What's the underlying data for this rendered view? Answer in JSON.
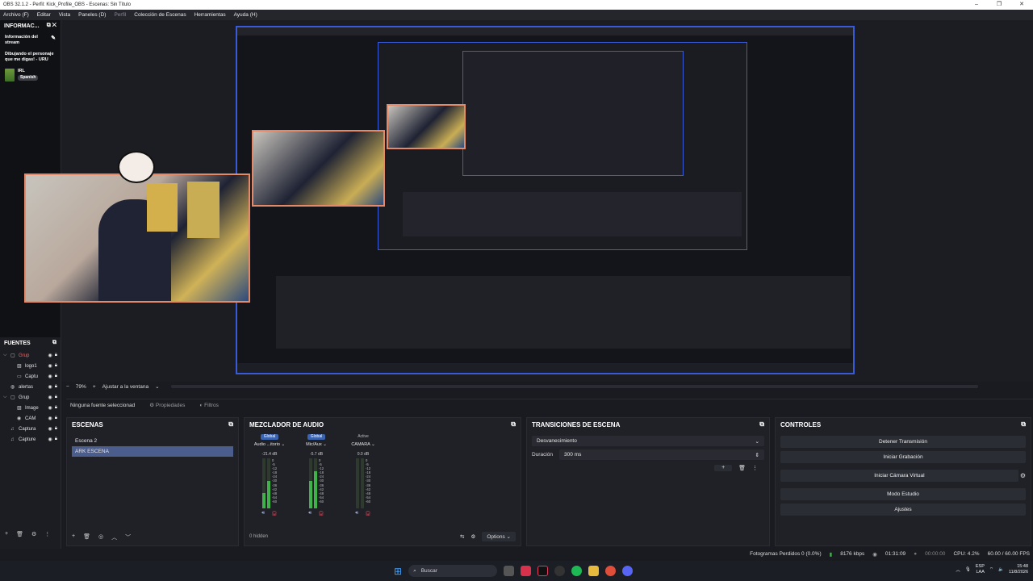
{
  "window": {
    "title": "OBS 32.1.2 - Perfil: Kick_Profile_OBS - Escenas: Sin Título",
    "controls": [
      "–",
      "❐",
      "✕"
    ]
  },
  "menu": [
    "Archivo (F)",
    "Editar",
    "Vista",
    "Paneles (D)",
    "Perfil",
    "Colección de Escenas",
    "Herramientas",
    "Ayuda (H)"
  ],
  "info_dock": {
    "title": "INFORMAC...",
    "heading": "Información del stream",
    "stream_title": "Dibujando el personaje que me digas! - URU",
    "category": "IRL",
    "language": "Spanish"
  },
  "sources": {
    "title": "FUENTES",
    "items": [
      {
        "name": "Grup",
        "arrow": "⌵",
        "icon": "folder-icon",
        "glyph": "▢",
        "indent": false,
        "highlight": true
      },
      {
        "name": "logo1",
        "arrow": "",
        "icon": "image-icon",
        "glyph": "▨",
        "indent": true,
        "highlight": false
      },
      {
        "name": "Captu",
        "arrow": "",
        "icon": "capture-icon",
        "glyph": "▭",
        "indent": true,
        "highlight": false
      },
      {
        "name": "alertas",
        "arrow": "",
        "icon": "browser-icon",
        "glyph": "◍",
        "indent": false,
        "highlight": false
      },
      {
        "name": "Grup",
        "arrow": "⌵",
        "icon": "folder-icon",
        "glyph": "▢",
        "indent": false,
        "highlight": false
      },
      {
        "name": "Image",
        "arrow": "",
        "icon": "image-icon",
        "glyph": "▨",
        "indent": true,
        "highlight": false
      },
      {
        "name": "CAM",
        "arrow": "",
        "icon": "camera-icon",
        "glyph": "◉",
        "indent": true,
        "highlight": false
      },
      {
        "name": "Captura",
        "arrow": "",
        "icon": "audio-capture-icon",
        "glyph": "♫",
        "indent": false,
        "highlight": false
      },
      {
        "name": "Capture",
        "arrow": "",
        "icon": "audio-capture-icon",
        "glyph": "♫",
        "indent": false,
        "highlight": false
      }
    ]
  },
  "preview": {
    "zoom": "79%",
    "fit": "Ajustar a la ventana"
  },
  "props_bar": {
    "no_source": "Ninguna fuente seleccionad",
    "properties": "Propiedades",
    "filters": "Filtros"
  },
  "scenes": {
    "title": "ESCENAS",
    "items": [
      "Escena 2",
      "ARK ESCENA"
    ],
    "selected": 1
  },
  "mixer": {
    "title": "MEZCLADOR DE AUDIO",
    "hidden": "0 hidden",
    "options": "Options",
    "channels": [
      {
        "badge": "Global",
        "name": "Audio ...itorio",
        "db": "-21.4 dB",
        "level": 0.3,
        "peak": 0.55
      },
      {
        "badge": "Global",
        "name": "Mic/Aux",
        "db": "-5.7 dB",
        "level": 0.55,
        "peak": 0.75
      },
      {
        "badge": "Active",
        "name": "CAMARA",
        "db": "0.0 dB",
        "level": 0.0,
        "peak": 0.0
      }
    ],
    "scale": [
      "0",
      "-5",
      "-12",
      "-18",
      "-24",
      "-30",
      "-36",
      "-42",
      "-48",
      "-54",
      "-60"
    ]
  },
  "transitions": {
    "title": "TRANSICIONES DE ESCENA",
    "type": "Desvanecimiento",
    "duration_label": "Duración",
    "duration": "300 ms"
  },
  "controls": {
    "title": "CONTROLES",
    "buttons": [
      "Detener Transmisión",
      "Iniciar Grabación",
      "Iniciar Cámara Virtual",
      "Modo Estudio",
      "Ajustes"
    ]
  },
  "status": {
    "dropped": "Fotogramas Perdidos 0 (0.0%)",
    "bitrate": "8176 kbps",
    "live_time": "01:31:09",
    "rec_time": "00:00:00",
    "cpu": "CPU: 4.2%",
    "fps": "60.00 / 60.00 FPS"
  },
  "taskbar": {
    "search": "Buscar",
    "lang1": "ESP",
    "lang2": "LAA",
    "time": "15:48",
    "date": "11/8/2026"
  },
  "colors": {
    "accent": "#4b5d8c",
    "badge": "#3a64b0",
    "meter_green": "#3fb24a",
    "bg": "#1a1b20"
  }
}
